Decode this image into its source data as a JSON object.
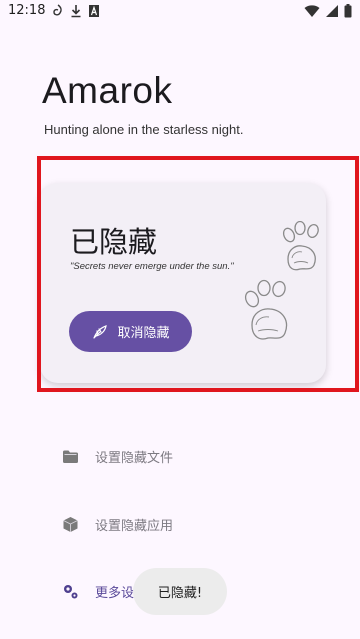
{
  "status_bar": {
    "time": "12:18"
  },
  "header": {
    "title": "Amarok",
    "subtitle": "Hunting alone in the starless night."
  },
  "card": {
    "status_title": "已隐藏",
    "quote": "\"Secrets never emerge under the sun.\"",
    "unhide_button_label": "取消隐藏"
  },
  "menu": {
    "items": [
      {
        "label": "设置隐藏文件",
        "icon": "folder-icon"
      },
      {
        "label": "设置隐藏应用",
        "icon": "app-box-icon"
      },
      {
        "label": "更多设置",
        "icon": "settings-gears-icon"
      }
    ]
  },
  "toast": {
    "message": "已隐藏!"
  },
  "colors": {
    "background": "#fdf7ff",
    "accent": "#6650a4",
    "card_background": "#f3eff6",
    "highlight": "#e0161e"
  }
}
